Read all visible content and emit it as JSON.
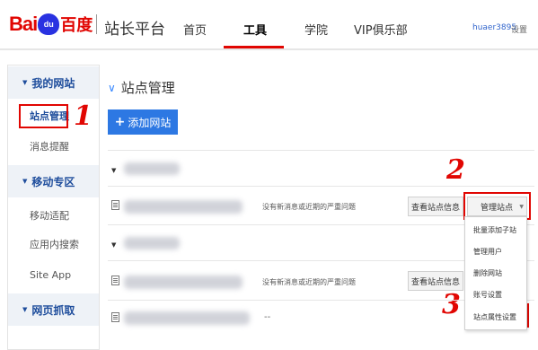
{
  "header": {
    "logo": {
      "bai": "Bai",
      "paw": "du",
      "du": "百度"
    },
    "site_title": "站长平台",
    "nav": [
      "首页",
      "工具",
      "学院",
      "VIP俱乐部"
    ],
    "active_nav": "工具",
    "user": "huaer3895",
    "settings": "设置",
    "accent_color": "#e10602"
  },
  "sidebar": {
    "groups": [
      {
        "label": "我的网站",
        "items": [
          "站点管理",
          "消息提醒"
        ]
      },
      {
        "label": "移动专区",
        "items": [
          "移动适配",
          "应用内搜索",
          "Site App"
        ]
      },
      {
        "label": "网页抓取",
        "items": []
      }
    ],
    "active_item": "站点管理"
  },
  "main": {
    "title": "站点管理",
    "add_button": "添加网站",
    "add_plus": "+",
    "rows": [
      {
        "message": "没有新消息或近期的严重问题",
        "info_button": "查看站点信息",
        "manage_button": "管理站点"
      },
      {
        "message": "没有新消息或近期的严重问题",
        "info_button": "查看站点信息"
      },
      {
        "message": "--"
      }
    ],
    "manage_menu": [
      "批量添加子站",
      "管理用户",
      "删除网站",
      "账号设置",
      "站点属性设置"
    ]
  },
  "annotations": {
    "marks": [
      "1",
      "2",
      "3"
    ],
    "color": "#e10602"
  },
  "icons": {
    "collapse": "triangle-down-icon",
    "doc": "document-icon",
    "title_chevron": "chevron-down-icon",
    "dropdown": "caret-down-icon"
  }
}
